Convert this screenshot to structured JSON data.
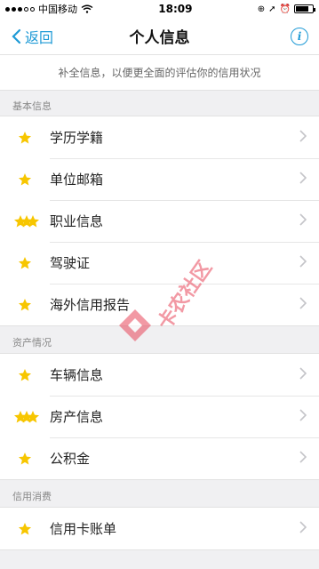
{
  "status_bar": {
    "carrier": "中国移动",
    "time": "18:09"
  },
  "nav": {
    "back_label": "返回",
    "title": "个人信息",
    "info_icon": "info-icon"
  },
  "notice": "补全信息，以便更全面的评估你的信用状况",
  "sections": [
    {
      "title": "基本信息",
      "items": [
        {
          "label": "学历学籍",
          "stars": 1
        },
        {
          "label": "单位邮箱",
          "stars": 1
        },
        {
          "label": "职业信息",
          "stars": 3
        },
        {
          "label": "驾驶证",
          "stars": 1
        },
        {
          "label": "海外信用报告",
          "stars": 1
        }
      ]
    },
    {
      "title": "资产情况",
      "items": [
        {
          "label": "车辆信息",
          "stars": 1
        },
        {
          "label": "房产信息",
          "stars": 3
        },
        {
          "label": "公积金",
          "stars": 1
        }
      ]
    },
    {
      "title": "信用消费",
      "items": [
        {
          "label": "信用卡账单",
          "stars": 1
        }
      ]
    }
  ],
  "watermark": "卡农社区",
  "colors": {
    "accent": "#1e9ad6",
    "star": "#f7c600",
    "watermark": "#e8475a"
  }
}
